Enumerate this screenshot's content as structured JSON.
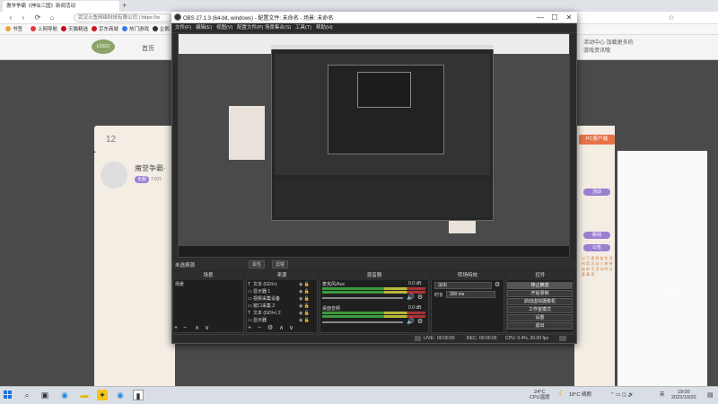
{
  "browser": {
    "tabs": [
      {
        "label": "傲学争霸《神仙三国》新闻活动"
      },
      {
        "label": "+"
      }
    ],
    "address": "武汉火鱼网络科技有限公司 | https://w",
    "nav": {
      "back": "‹",
      "forward": "›",
      "reload": "⟳",
      "home": "⌂",
      "star": "☆"
    },
    "favorites": [
      {
        "label": "书签",
        "color": "#e8a23a"
      },
      {
        "label": "上网导航",
        "color": "#e83a3a"
      },
      {
        "label": "天猫精选",
        "color": "#d0021b"
      },
      {
        "label": "京东商城",
        "color": "#c9151e"
      },
      {
        "label": "热门游戏",
        "color": "#3a7ae8"
      },
      {
        "label": "企鹅",
        "color": "#333"
      }
    ]
  },
  "site": {
    "home": "首页",
    "right_link": "活动中心 加载更多的游戏资讯哦",
    "card_num": "12",
    "card_title": "魔誉争霸·",
    "tags": [
      "全服",
      "7.0只"
    ],
    "pc_button": "PC客户端",
    "side_tags": [
      "活动",
      "新闻",
      "公告"
    ],
    "long_text": "以 下 视 频 前 生 活 内 容 活 动 人 物 参 加 前 生 活 动 的 注 意 事 项"
  },
  "obs": {
    "title": "OBS 27.1.3 (64-bit, windows) - 配置文件: 未命名 - 场景: 未命名",
    "window_buttons": {
      "min": "—",
      "max": "☐",
      "close": "✕"
    },
    "menu": [
      "文件(F)",
      "编辑(E)",
      "视图(V)",
      "配置文件(P)",
      "场景集合(S)",
      "工具(T)",
      "帮助(H)"
    ],
    "scene_bar": {
      "label": "未选择源",
      "properties": "属性",
      "filters": "滤镜"
    },
    "docks": {
      "scenes": {
        "title": "场景",
        "items": [
          "场景"
        ]
      },
      "sources": {
        "title": "来源",
        "items": [
          {
            "icon": "T",
            "label": "文本 (GDI+)"
          },
          {
            "icon": "▭",
            "label": "显示器 1"
          },
          {
            "icon": "▭",
            "label": "视频采集设备"
          },
          {
            "icon": "▭",
            "label": "窗口采集 2"
          },
          {
            "icon": "T",
            "label": "文本 (GDI+) 2"
          },
          {
            "icon": "▭",
            "label": "显示器"
          }
        ]
      },
      "mixer": {
        "title": "混音器",
        "channels": [
          {
            "name": "麦克风/Aux",
            "db": "0.0 dB"
          },
          {
            "name": "桌面音频",
            "db": "0.0 dB"
          }
        ]
      },
      "transitions": {
        "title": "转场特效",
        "type": "淡出",
        "duration_label": "时长",
        "duration": "300 ms"
      },
      "controls": {
        "title": "控件",
        "buttons": [
          "停止推流",
          "开始录制",
          "启动虚拟摄像机",
          "工作室模式",
          "设置",
          "退出"
        ]
      }
    },
    "toolbar": {
      "add": "+",
      "remove": "−",
      "settings": "⚙",
      "up": "∧",
      "down": "∨"
    },
    "status": {
      "live_label": "LIVE:",
      "live_time": "00:00:00",
      "rec_label": "REC:",
      "rec_time": "00:00:00",
      "cpu": "CPU: 0.4%, 30.00 fps"
    }
  },
  "taskbar": {
    "weather": {
      "temp": "24°C",
      "label": "CPU温度"
    },
    "weather2": "18°C 晴朗",
    "time": "19:00",
    "date": "2022/10/20",
    "ime": "英"
  },
  "colors": {
    "accent": "#1e6fd9",
    "obs_bg": "#2b2b2b",
    "stop_btn": "#555555"
  }
}
